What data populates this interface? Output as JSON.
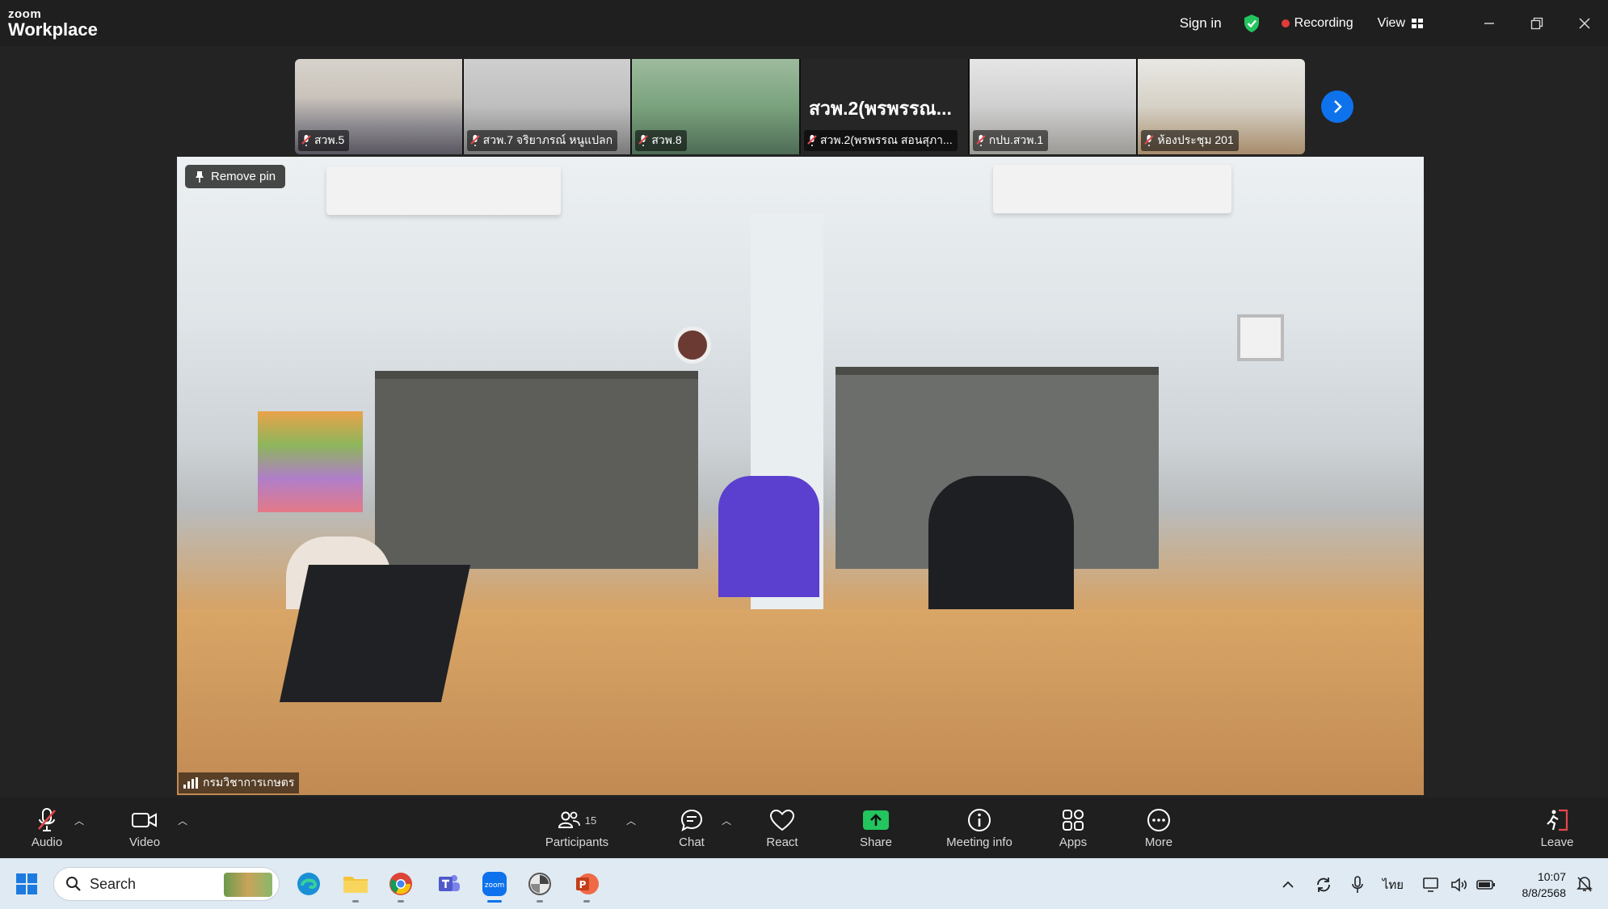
{
  "titlebar": {
    "brand_small": "zoom",
    "brand_big": "Workplace",
    "sign_in": "Sign in",
    "recording": "Recording",
    "view": "View"
  },
  "gallery": {
    "tiles": [
      {
        "name": "สวพ.5"
      },
      {
        "name": "สวพ.7 จริยาภรณ์ หนูแปลก"
      },
      {
        "name": "สวพ.8"
      },
      {
        "name": "สวพ.2(พรพรรณ สอนสุภา...",
        "display_name": "สวพ.2(พรพรรณ..."
      },
      {
        "name": "กปบ.สวพ.1"
      },
      {
        "name": "ห้องประชุม 201"
      }
    ]
  },
  "main_video": {
    "remove_pin": "Remove pin",
    "speaker_name": "กรมวิชาการเกษตร"
  },
  "controls": {
    "audio": "Audio",
    "video": "Video",
    "participants": "Participants",
    "participants_count": "15",
    "chat": "Chat",
    "react": "React",
    "share": "Share",
    "meeting_info": "Meeting info",
    "apps": "Apps",
    "more": "More",
    "leave": "Leave"
  },
  "taskbar": {
    "search": "Search",
    "language": "ไทย",
    "time": "10:07",
    "date": "8/8/2568"
  },
  "colors": {
    "accent_blue": "#0e72ed",
    "share_green": "#22c55e",
    "recording_red": "#e43a3a",
    "leave_red": "#e5484d"
  }
}
